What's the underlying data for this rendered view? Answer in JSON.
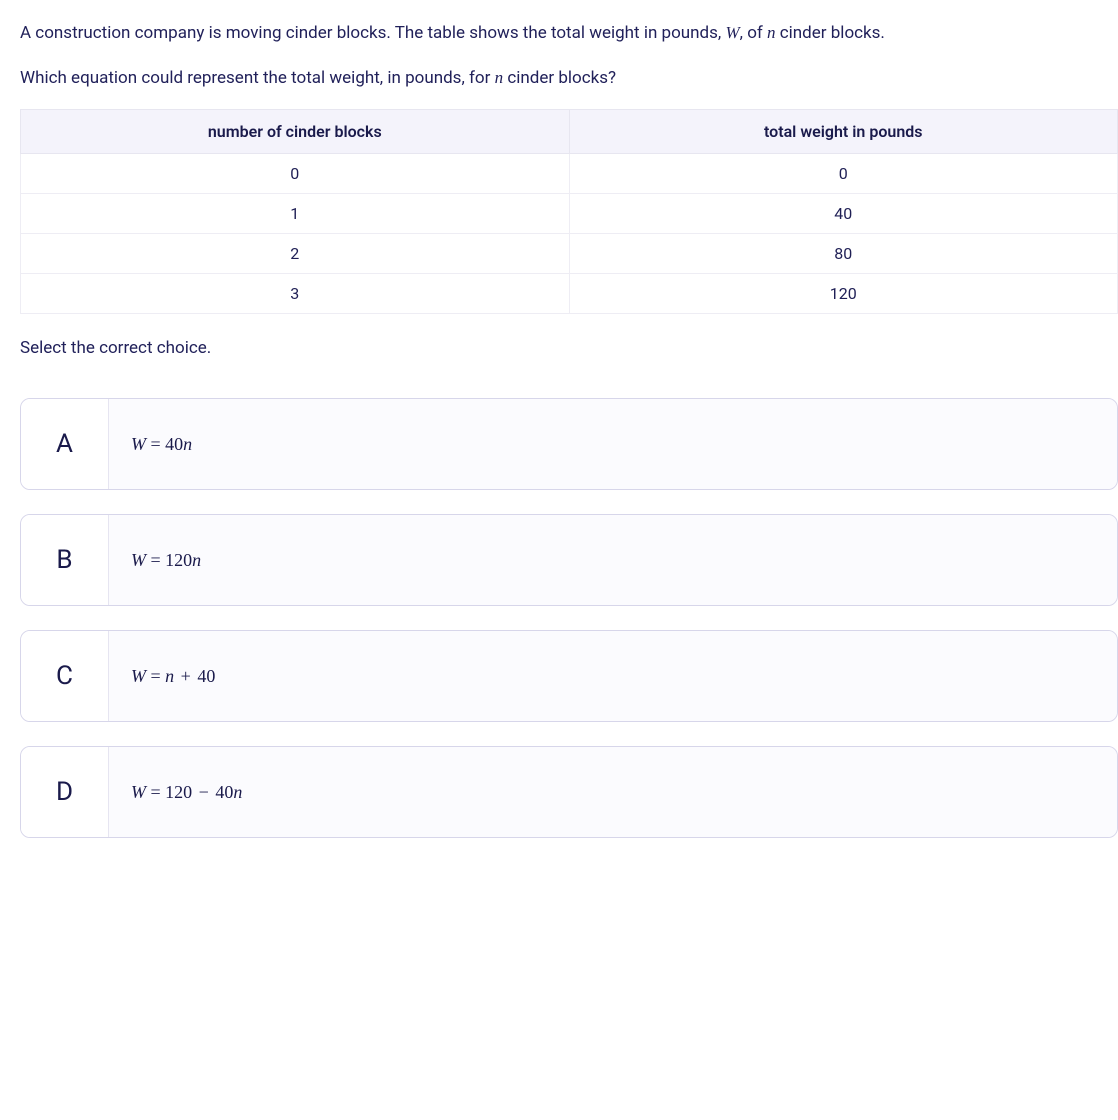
{
  "question": {
    "line1_prefix": "A construction company is moving cinder blocks. The table shows the total weight in pounds, ",
    "var_W": "W",
    "line1_mid": ", of ",
    "var_n": "n",
    "line1_suffix": " cinder blocks.",
    "line2_prefix": "Which equation could represent the total weight, in pounds, for ",
    "line2_suffix": " cinder blocks?"
  },
  "table": {
    "headers": [
      "number of cinder blocks",
      "total weight in pounds"
    ],
    "rows": [
      [
        "0",
        "0"
      ],
      [
        "1",
        "40"
      ],
      [
        "2",
        "80"
      ],
      [
        "3",
        "120"
      ]
    ]
  },
  "instruction": "Select the correct choice.",
  "choices": [
    {
      "letter": "A",
      "lhs": "W",
      "rhs_pre": "40",
      "rhs_var": "n",
      "rhs_post": "",
      "op": "=",
      "op2": "",
      "rhs2": ""
    },
    {
      "letter": "B",
      "lhs": "W",
      "rhs_pre": "120",
      "rhs_var": "n",
      "rhs_post": "",
      "op": "=",
      "op2": "",
      "rhs2": ""
    },
    {
      "letter": "C",
      "lhs": "W",
      "rhs_pre": "",
      "rhs_var": "n",
      "rhs_post": "",
      "op": "=",
      "op2": "+",
      "rhs2": "40"
    },
    {
      "letter": "D",
      "lhs": "W",
      "rhs_pre": "120",
      "rhs_var": "",
      "rhs_post": "",
      "op": "=",
      "op2": "−",
      "rhs2_pre": "40",
      "rhs2_var": "n"
    }
  ]
}
